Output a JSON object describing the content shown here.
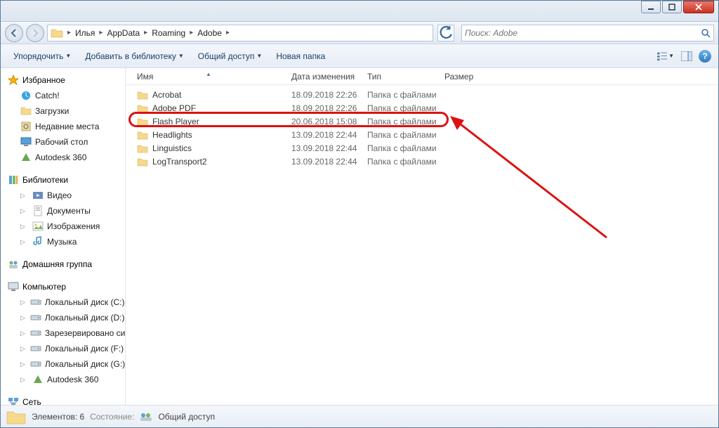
{
  "breadcrumb": [
    "Илья",
    "AppData",
    "Roaming",
    "Adobe"
  ],
  "search": {
    "placeholder": "Поиск: Adobe"
  },
  "toolbar": {
    "organize": "Упорядочить",
    "addlib": "Добавить в библиотеку",
    "share": "Общий доступ",
    "newfolder": "Новая папка"
  },
  "columns": {
    "name": "Имя",
    "date": "Дата изменения",
    "type": "Тип",
    "size": "Размер"
  },
  "rows": [
    {
      "name": "Acrobat",
      "date": "18.09.2018 22:26",
      "type": "Папка с файлами"
    },
    {
      "name": "Adobe PDF",
      "date": "18.09.2018 22:26",
      "type": "Папка с файлами"
    },
    {
      "name": "Flash Player",
      "date": "20.06.2018 15:08",
      "type": "Папка с файлами"
    },
    {
      "name": "Headlights",
      "date": "13.09.2018 22:44",
      "type": "Папка с файлами"
    },
    {
      "name": "Linguistics",
      "date": "13.09.2018 22:44",
      "type": "Папка с файлами"
    },
    {
      "name": "LogTransport2",
      "date": "13.09.2018 22:44",
      "type": "Папка с файлами"
    }
  ],
  "nav": {
    "favorites": {
      "label": "Избранное",
      "items": [
        "Catch!",
        "Загрузки",
        "Недавние места",
        "Рабочий стол",
        "Autodesk 360"
      ]
    },
    "libraries": {
      "label": "Библиотеки",
      "items": [
        "Видео",
        "Документы",
        "Изображения",
        "Музыка"
      ]
    },
    "homegroup": {
      "label": "Домашняя группа"
    },
    "computer": {
      "label": "Компьютер",
      "items": [
        "Локальный диск (C:)",
        "Локальный диск (D:)",
        "Зарезервировано системой",
        "Локальный диск (F:)",
        "Локальный диск (G:)",
        "Autodesk 360"
      ]
    },
    "network": {
      "label": "Сеть"
    }
  },
  "status": {
    "elements_label": "Элементов: 6",
    "state_label": "Состояние:",
    "shared": "Общий доступ"
  }
}
